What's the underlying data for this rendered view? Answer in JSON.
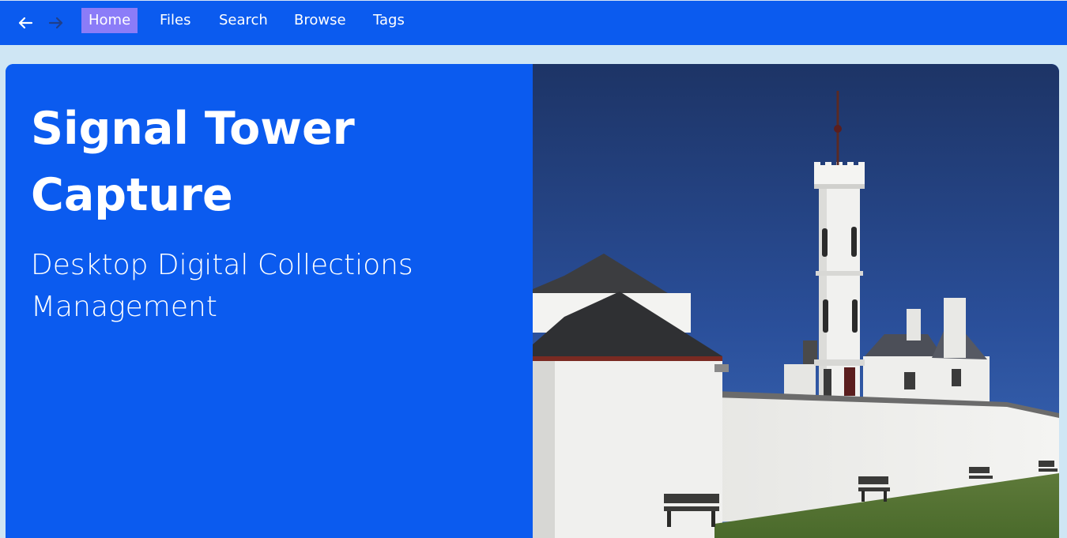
{
  "nav": {
    "back_icon": "arrow-left-icon",
    "forward_icon": "arrow-right-icon",
    "items": [
      {
        "label": "Home",
        "active": true
      },
      {
        "label": "Files",
        "active": false
      },
      {
        "label": "Search",
        "active": false
      },
      {
        "label": "Browse",
        "active": false
      },
      {
        "label": "Tags",
        "active": false
      }
    ]
  },
  "hero": {
    "title": "Signal Tower Capture",
    "subtitle": "Desktop Digital Collections Management",
    "image_alt": "Photograph of a white lighthouse signal tower with buildings and wall under a blue sky"
  },
  "colors": {
    "nav_bg": "#0b5bef",
    "active_tab": "#8b7cf8",
    "page_bg": "#cfe6f4",
    "hero_bg": "#0b5bef"
  }
}
